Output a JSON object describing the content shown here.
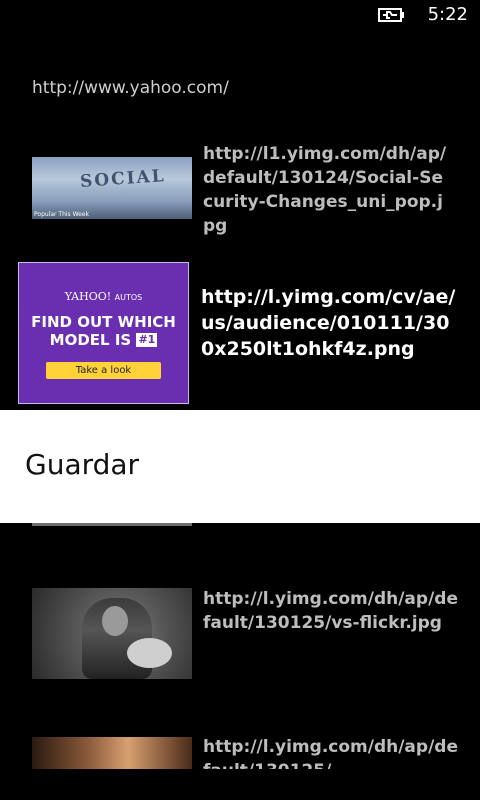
{
  "status": {
    "time": "5:22",
    "battery_icon": "battery-charging-icon"
  },
  "page": {
    "url": "http://www.yahoo.com/"
  },
  "items": [
    {
      "text": "http://l1.yimg.com/dh/ap/default/130124/Social-Security-Changes_uni_pop.jpg",
      "thumb_word": "SOCIAL",
      "thumb_caption": "Popular This Week"
    },
    {
      "text": "http://l.yimg.com/cv/ae/us/audience/010111/300x250lt1ohkf4z.png",
      "ad_brand": "YAHOO!",
      "ad_brand_sub": "AUTOS",
      "ad_headline_1": "FIND OUT WHICH",
      "ad_headline_2": "MODEL IS",
      "ad_badge": "#1",
      "ad_button": "Take a look"
    },
    {
      "text": "http://l.yimg.com/dh/ap/default/130125/vs-flickr.jpg"
    },
    {
      "text": "http://l.yimg.com/dh/ap/default/130125/"
    }
  ],
  "context_menu": {
    "items": [
      {
        "label": "Guardar"
      }
    ]
  }
}
